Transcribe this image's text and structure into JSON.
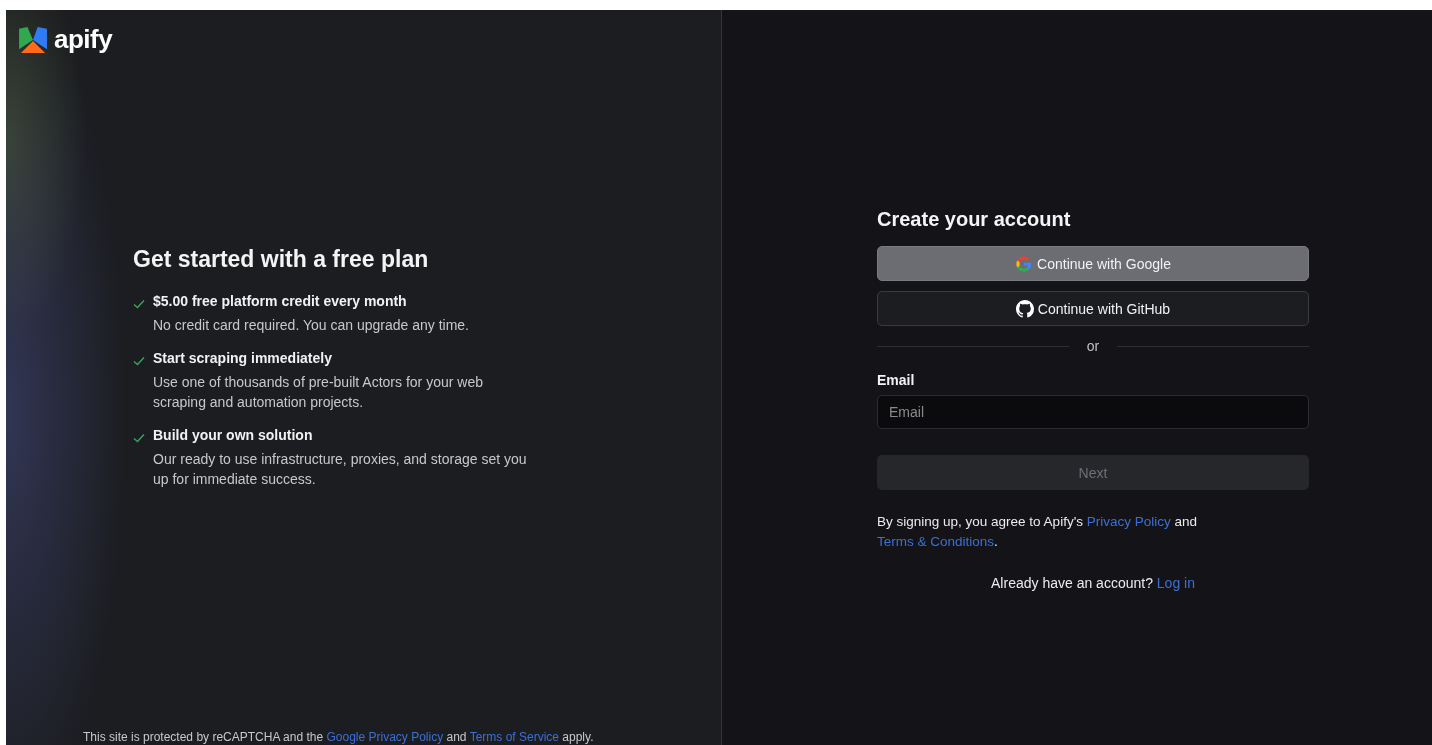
{
  "logo": {
    "text": "apify"
  },
  "intro": {
    "heading": "Get started with a free plan",
    "features": [
      {
        "title": "$5.00 free platform credit every month",
        "description": "No credit card required. You can upgrade any time."
      },
      {
        "title": "Start scraping immediately",
        "description": "Use one of thousands of pre-built Actors for your web scraping and automation projects."
      },
      {
        "title": "Build your own solution",
        "description": "Our ready to use infrastructure, proxies, and storage set you up for immediate success."
      }
    ]
  },
  "recaptcha_notice": [
    {
      "kind": "text",
      "text": "This site is protected by reCAPTCHA and the "
    },
    {
      "kind": "link",
      "text": "Google Privacy Policy"
    },
    {
      "kind": "text",
      "text": " and "
    },
    {
      "kind": "link",
      "text": "Terms of Service"
    },
    {
      "kind": "text",
      "text": " apply."
    }
  ],
  "signup": {
    "title": "Create your account",
    "providers": [
      {
        "kind": "google",
        "label": "Continue with Google",
        "highlighted": true
      },
      {
        "kind": "github",
        "label": "Continue with GitHub",
        "highlighted": false
      }
    ],
    "separator": "or",
    "email": {
      "label": "Email",
      "placeholder": "Email"
    },
    "next_button": {
      "label": "Next",
      "disabled": true
    },
    "terms": [
      {
        "kind": "text",
        "text": "By signing up, you agree to Apify's "
      },
      {
        "kind": "link",
        "text": "Privacy Policy"
      },
      {
        "kind": "text",
        "text": " and "
      },
      {
        "kind": "link",
        "text": "Terms & Conditions"
      },
      {
        "kind": "text",
        "text": "."
      }
    ],
    "login_prompt": [
      {
        "kind": "text",
        "text": "Already have an account? "
      },
      {
        "kind": "link",
        "text": "Log in"
      }
    ]
  }
}
